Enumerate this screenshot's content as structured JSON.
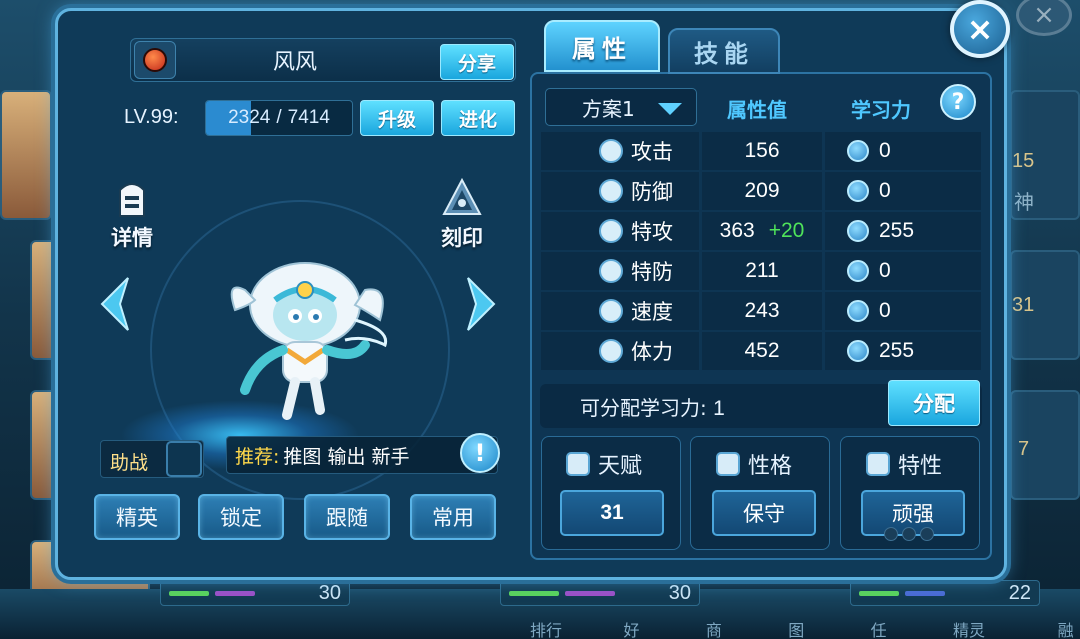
{
  "dialog": {
    "pet_name": "风风",
    "share_label": "分享",
    "level_label": "LV.99:",
    "xp_current": "2324",
    "xp_sep": "/",
    "xp_max": "7414",
    "xp_fraction": 0.31,
    "upgrade_label": "升级",
    "evolve_label": "进化",
    "details_label": "详情",
    "imprint_label": "刻印",
    "support_label": "助战",
    "recommend_tag": "推荐:",
    "recommend_values": "推图 输出 新手",
    "recommend_info_icon": "!",
    "bottom_buttons": [
      "精英",
      "锁定",
      "跟随",
      "常用"
    ],
    "close_icon": "×"
  },
  "tabs": {
    "attributes": "属性",
    "skills": "技能"
  },
  "stats": {
    "plan_label": "方案1",
    "col_value": "属性值",
    "col_learning": "学习力",
    "help_icon": "?",
    "rows": [
      {
        "name": "攻击",
        "value": "156",
        "bonus": "",
        "learning": "0"
      },
      {
        "name": "防御",
        "value": "209",
        "bonus": "",
        "learning": "0"
      },
      {
        "name": "特攻",
        "value": "363",
        "bonus": "+20",
        "learning": "255"
      },
      {
        "name": "特防",
        "value": "211",
        "bonus": "",
        "learning": "0"
      },
      {
        "name": "速度",
        "value": "243",
        "bonus": "",
        "learning": "0"
      },
      {
        "name": "体力",
        "value": "452",
        "bonus": "",
        "learning": "255"
      }
    ],
    "allocatable_label": "可分配学习力:",
    "allocatable_value": "1",
    "allocate_button": "分配"
  },
  "attributes": {
    "talent_label": "天赋",
    "talent_value": "31",
    "nature_label": "性格",
    "nature_value": "保守",
    "trait_label": "特性",
    "trait_value": "顽强"
  },
  "background": {
    "side_numbers": [
      "15",
      "神",
      "31",
      "7"
    ],
    "bar_numbers": [
      "30",
      "30",
      "22"
    ],
    "nav_items": [
      "排行榜",
      "好友",
      "商店",
      "图鉴",
      "任务",
      "精灵强化",
      "融合"
    ]
  }
}
